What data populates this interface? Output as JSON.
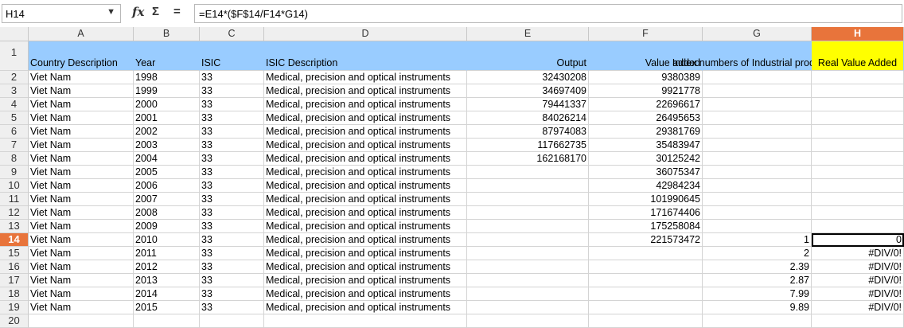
{
  "formula_bar": {
    "cell_ref": "H14",
    "formula": "=E14*($F$14/F14*G14)",
    "fx_label": "fx",
    "sum_label": "Σ",
    "equals_label": "="
  },
  "columns": [
    "A",
    "B",
    "C",
    "D",
    "E",
    "F",
    "G",
    "H"
  ],
  "selected_column": "H",
  "selected_row": "14",
  "headers": {
    "country": "Country Description",
    "year": "Year",
    "isic": "ISIC",
    "isic_desc": "ISIC Description",
    "output": "Output",
    "value_added": "Value added",
    "index": "Index numbers of Industrial production",
    "real_value": "Real Value Added"
  },
  "rows": [
    {
      "row": "2",
      "country": "Viet Nam",
      "year": "1998",
      "isic": "33",
      "desc": "Medical, precision and optical instruments",
      "output": "32430208",
      "value_added": "9380389",
      "index": "",
      "real": ""
    },
    {
      "row": "3",
      "country": "Viet Nam",
      "year": "1999",
      "isic": "33",
      "desc": "Medical, precision and optical instruments",
      "output": "34697409",
      "value_added": "9921778",
      "index": "",
      "real": ""
    },
    {
      "row": "4",
      "country": "Viet Nam",
      "year": "2000",
      "isic": "33",
      "desc": "Medical, precision and optical instruments",
      "output": "79441337",
      "value_added": "22696617",
      "index": "",
      "real": ""
    },
    {
      "row": "5",
      "country": "Viet Nam",
      "year": "2001",
      "isic": "33",
      "desc": "Medical, precision and optical instruments",
      "output": "84026214",
      "value_added": "26495653",
      "index": "",
      "real": ""
    },
    {
      "row": "6",
      "country": "Viet Nam",
      "year": "2002",
      "isic": "33",
      "desc": "Medical, precision and optical instruments",
      "output": "87974083",
      "value_added": "29381769",
      "index": "",
      "real": ""
    },
    {
      "row": "7",
      "country": "Viet Nam",
      "year": "2003",
      "isic": "33",
      "desc": "Medical, precision and optical instruments",
      "output": "117662735",
      "value_added": "35483947",
      "index": "",
      "real": ""
    },
    {
      "row": "8",
      "country": "Viet Nam",
      "year": "2004",
      "isic": "33",
      "desc": "Medical, precision and optical instruments",
      "output": "162168170",
      "value_added": "30125242",
      "index": "",
      "real": ""
    },
    {
      "row": "9",
      "country": "Viet Nam",
      "year": "2005",
      "isic": "33",
      "desc": "Medical, precision and optical instruments",
      "output": "",
      "value_added": "36075347",
      "index": "",
      "real": ""
    },
    {
      "row": "10",
      "country": "Viet Nam",
      "year": "2006",
      "isic": "33",
      "desc": "Medical, precision and optical instruments",
      "output": "",
      "value_added": "42984234",
      "index": "",
      "real": ""
    },
    {
      "row": "11",
      "country": "Viet Nam",
      "year": "2007",
      "isic": "33",
      "desc": "Medical, precision and optical instruments",
      "output": "",
      "value_added": "101990645",
      "index": "",
      "real": ""
    },
    {
      "row": "12",
      "country": "Viet Nam",
      "year": "2008",
      "isic": "33",
      "desc": "Medical, precision and optical instruments",
      "output": "",
      "value_added": "171674406",
      "index": "",
      "real": ""
    },
    {
      "row": "13",
      "country": "Viet Nam",
      "year": "2009",
      "isic": "33",
      "desc": "Medical, precision and optical instruments",
      "output": "",
      "value_added": "175258084",
      "index": "",
      "real": ""
    },
    {
      "row": "14",
      "country": "Viet Nam",
      "year": "2010",
      "isic": "33",
      "desc": "Medical, precision and optical instruments",
      "output": "",
      "value_added": "221573472",
      "index": "1",
      "real": "0"
    },
    {
      "row": "15",
      "country": "Viet Nam",
      "year": "2011",
      "isic": "33",
      "desc": "Medical, precision and optical instruments",
      "output": "",
      "value_added": "",
      "index": "2",
      "real": "#DIV/0!"
    },
    {
      "row": "16",
      "country": "Viet Nam",
      "year": "2012",
      "isic": "33",
      "desc": "Medical, precision and optical instruments",
      "output": "",
      "value_added": "",
      "index": "2.39",
      "real": "#DIV/0!"
    },
    {
      "row": "17",
      "country": "Viet Nam",
      "year": "2013",
      "isic": "33",
      "desc": "Medical, precision and optical instruments",
      "output": "",
      "value_added": "",
      "index": "2.87",
      "real": "#DIV/0!"
    },
    {
      "row": "18",
      "country": "Viet Nam",
      "year": "2014",
      "isic": "33",
      "desc": "Medical, precision and optical instruments",
      "output": "",
      "value_added": "",
      "index": "7.99",
      "real": "#DIV/0!"
    },
    {
      "row": "19",
      "country": "Viet Nam",
      "year": "2015",
      "isic": "33",
      "desc": "Medical, precision and optical instruments",
      "output": "",
      "value_added": "",
      "index": "9.89",
      "real": "#DIV/0!"
    }
  ],
  "empty_rows": [
    "20"
  ],
  "header_row_label": "1",
  "colors": {
    "header_blue": "#99ccff",
    "highlight_yellow": "#ffff00",
    "selection_orange": "#e8743b"
  }
}
